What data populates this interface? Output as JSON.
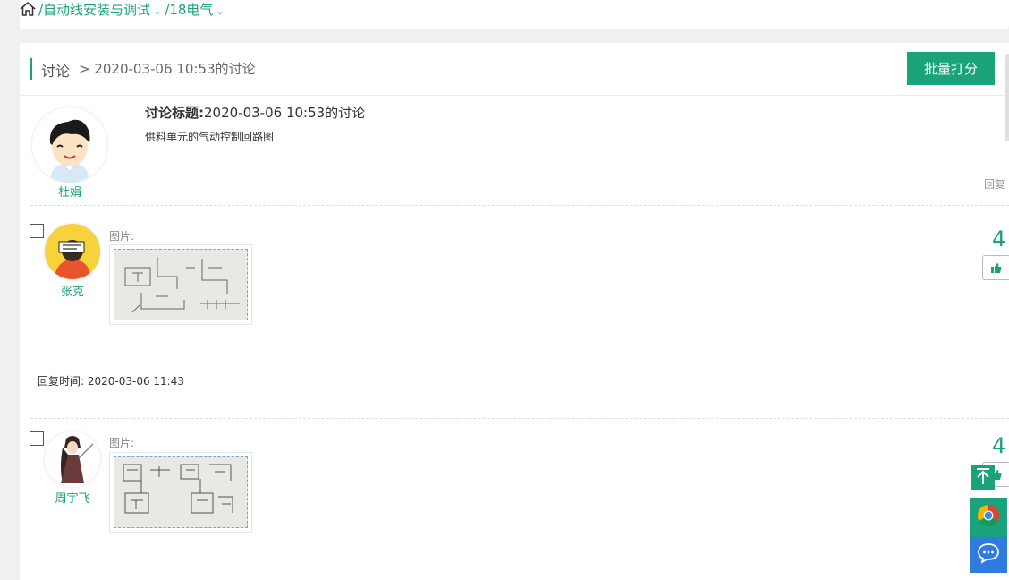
{
  "breadcrumb": {
    "items": [
      {
        "label": "/自动线安装与调试",
        "has_dropdown": true
      },
      {
        "label": "/18电气",
        "has_dropdown": true
      }
    ]
  },
  "header": {
    "title": "讨论",
    "subtitle": "> 2020-03-06 10:53的讨论",
    "batch_button": "批量打分"
  },
  "topic": {
    "author": "杜娟",
    "title_label": "讨论标题:",
    "title_value": "2020-03-06 10:53的讨论",
    "body": "供料单元的气动控制回路图",
    "reply_link": "回复"
  },
  "replies": [
    {
      "author": "张克",
      "image_label": "图片:",
      "score": "4",
      "reply_time": "回复时间: 2020-03-06 11:43"
    },
    {
      "author": "周宇飞",
      "image_label": "图片:",
      "score": "4"
    }
  ],
  "colors": {
    "accent": "#1aa27a",
    "float_blue": "#2f7be0"
  },
  "icons": [
    "home-icon",
    "chevron-down-icon",
    "thumbs-up-icon",
    "back-to-top-icon",
    "chrome-icon",
    "chat-icon"
  ]
}
